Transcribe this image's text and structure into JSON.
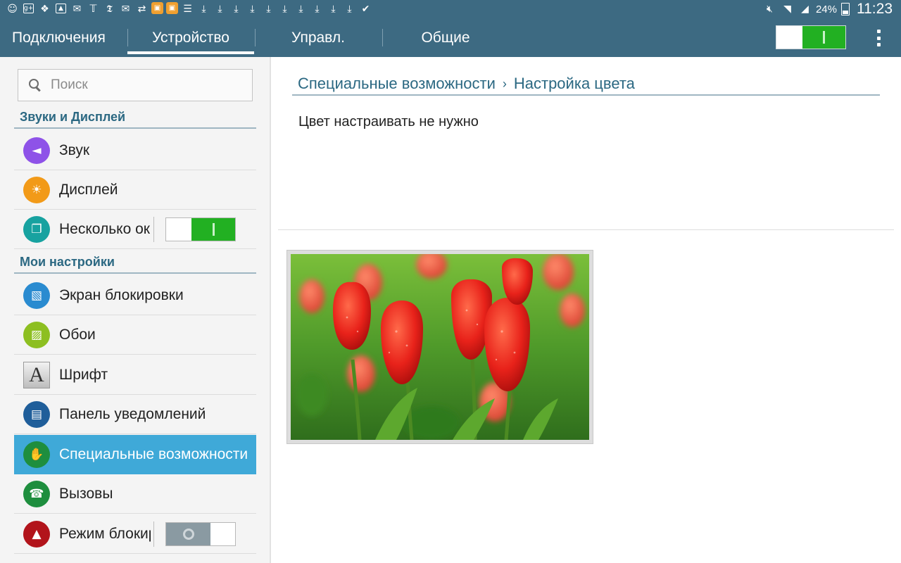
{
  "status_bar": {
    "battery": "24%",
    "time": "11:23"
  },
  "tabs": [
    {
      "label": "Подключения",
      "active": false
    },
    {
      "label": "Устройство",
      "active": true
    },
    {
      "label": "Управл.",
      "active": false
    },
    {
      "label": "Общие",
      "active": false
    }
  ],
  "sidebar": {
    "search_placeholder": "Поиск",
    "sections": [
      {
        "title": "Звуки и Дисплей",
        "items": [
          {
            "label": "Звук",
            "icon": "speaker-icon",
            "color": "#8e52e8"
          },
          {
            "label": "Дисплей",
            "icon": "brightness-icon",
            "color": "#f29a18"
          },
          {
            "label": "Несколько окон",
            "icon": "multi-window-icon",
            "color": "#17a2a0",
            "toggle": "on"
          }
        ]
      },
      {
        "title": "Мои настройки",
        "items": [
          {
            "label": "Экран блокировки",
            "icon": "lock-screen-icon",
            "color": "#2a8bd0"
          },
          {
            "label": "Обои",
            "icon": "wallpaper-icon",
            "color": "#8dbf21"
          },
          {
            "label": "Шрифт",
            "icon": "font-icon",
            "color": "#bdbdbd"
          },
          {
            "label": "Панель уведомлений",
            "icon": "notification-panel-icon",
            "color": "#1f5e9a"
          },
          {
            "label": "Специальные возможности",
            "icon": "hand-icon",
            "color": "#1e8e3e",
            "selected": true
          },
          {
            "label": "Вызовы",
            "icon": "phone-icon",
            "color": "#1e8e3e"
          },
          {
            "label": "Режим блокировки",
            "icon": "blocking-mode-icon",
            "color": "#b2141b",
            "toggle": "off"
          }
        ]
      }
    ]
  },
  "main": {
    "breadcrumb": [
      "Специальные возможности",
      "Настройка цвета"
    ],
    "message": "Цвет настраивать не нужно"
  },
  "colors": {
    "header": "#3d6a82",
    "accent": "#2b6882",
    "selected": "#3fa9d8",
    "toggle_on": "#22b022"
  }
}
